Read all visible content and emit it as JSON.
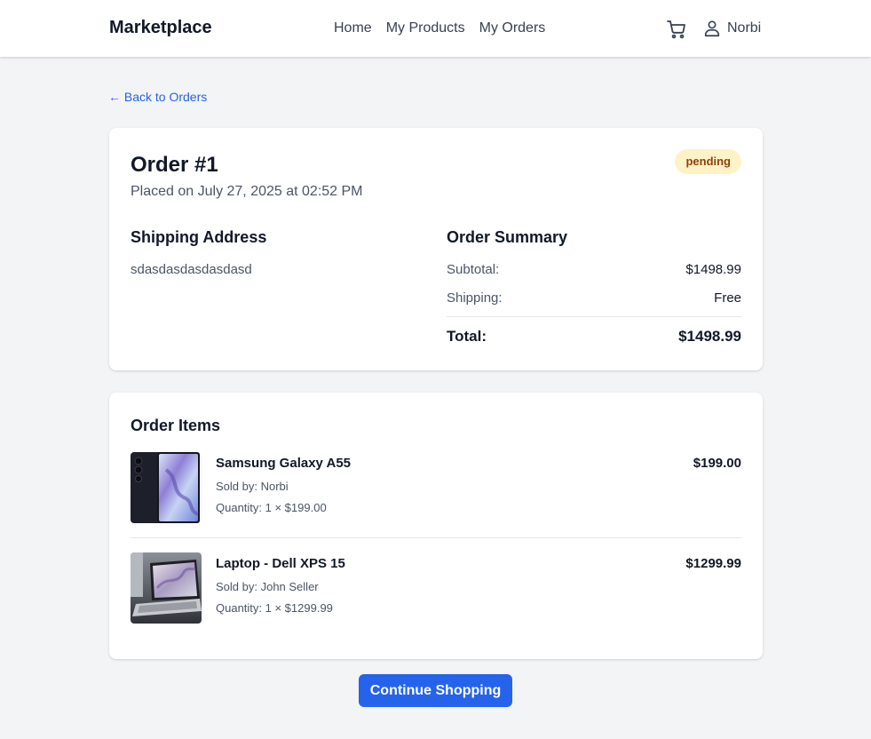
{
  "header": {
    "brand": "Marketplace",
    "nav": [
      "Home",
      "My Products",
      "My Orders"
    ],
    "cart_icon": "shopping-cart-icon",
    "user_icon": "user-icon",
    "user_name": "Norbi"
  },
  "back_link": "← Back to Orders",
  "order": {
    "title": "Order #1",
    "placed": "Placed on July 27, 2025 at 02:52 PM",
    "status": "pending",
    "status_color": "#fef3c7",
    "shipping_heading": "Shipping Address",
    "shipping_address": "sdasdasdasdasdasd",
    "summary_heading": "Order Summary",
    "subtotal_label": "Subtotal:",
    "subtotal_value": "$1498.99",
    "shipping_label": "Shipping:",
    "shipping_value": "Free",
    "total_label": "Total:",
    "total_value": "$1498.99"
  },
  "items_section": {
    "heading": "Order Items",
    "items": [
      {
        "name": "Samsung Galaxy A55",
        "seller": "Sold by: Norbi",
        "quantity": "Quantity: 1 × $199.00",
        "price": "$199.00"
      },
      {
        "name": "Laptop - Dell XPS 15",
        "seller": "Sold by: John Seller",
        "quantity": "Quantity: 1 × $1299.99",
        "price": "$1299.99"
      }
    ]
  },
  "continue_button": "Continue Shopping",
  "accent_color": "#2563eb"
}
